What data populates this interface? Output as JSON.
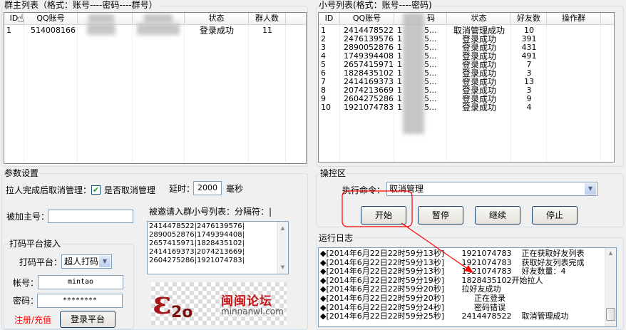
{
  "master_list": {
    "title": "群主列表（格式：账号----密码----群号）",
    "columns": [
      "ID",
      "QQ账号",
      "",
      "",
      "状态",
      "群人数"
    ],
    "rows": [
      {
        "id": "1",
        "qq": "514008166",
        "status": "登录成功",
        "count": "11"
      }
    ]
  },
  "sub_list": {
    "title": "小号列表(格式：账号----密码)",
    "columns": [
      "ID",
      "QQ账号",
      "码",
      "状态",
      "好友数",
      "操作群"
    ],
    "rows": [
      {
        "id": "1",
        "qq": "2414478522",
        "pw_a": "1",
        "pw_b": "5...",
        "status": "取消管理成功",
        "friends": "10"
      },
      {
        "id": "2",
        "qq": "2476139576",
        "pw_a": "1",
        "pw_b": "5...",
        "status": "登录成功",
        "friends": "391"
      },
      {
        "id": "3",
        "qq": "2890052876",
        "pw_a": "1",
        "pw_b": "5...",
        "status": "登录成功",
        "friends": "431"
      },
      {
        "id": "4",
        "qq": "1749394408",
        "pw_a": "1",
        "pw_b": "5...",
        "status": "登录成功",
        "friends": "491"
      },
      {
        "id": "5",
        "qq": "2657415971",
        "pw_a": "1",
        "pw_b": "5...",
        "status": "登录成功",
        "friends": "7"
      },
      {
        "id": "6",
        "qq": "1828435102",
        "pw_a": "1",
        "pw_b": "5...",
        "status": "登录成功",
        "friends": "3"
      },
      {
        "id": "7",
        "qq": "2414169373",
        "pw_a": "1",
        "pw_b": "5...",
        "status": "登录成功",
        "friends": "13"
      },
      {
        "id": "8",
        "qq": "2074213669",
        "pw_a": "1",
        "pw_b": "5...",
        "status": "登录成功",
        "friends": "3"
      },
      {
        "id": "9",
        "qq": "2604275286",
        "pw_a": "1",
        "pw_b": "5...",
        "status": "登录成功",
        "friends": "9"
      },
      {
        "id": "10",
        "qq": "1921074783",
        "pw_a": "1",
        "pw_b": "5...",
        "status": "登录成功",
        "friends": "4"
      }
    ]
  },
  "params": {
    "title": "参数设置",
    "cancel_admin_label": "拉人完成后取消管理：",
    "cancel_admin_checkbox": "是否取消管理",
    "cancel_admin_checked": true,
    "delay_label": "延时：",
    "delay_value": "2000",
    "delay_unit": "毫秒",
    "master_label": "被加主号：",
    "master_value": "",
    "invite_label": "被邀请入群小号列表：分隔符：|",
    "invite_lines": [
      "2414478522|2476139576|",
      "2890052876|1749394408|",
      "2657415971|1828435102|",
      "2414169373|2074213669|",
      "2604275286|1921074783|"
    ],
    "captcha": {
      "title": "打码平台接入",
      "platform_label": "打码平台：",
      "platform_value": "超人打码",
      "account_label": "帐号：",
      "account_value": "mintao",
      "password_label": "密码：",
      "password_value": "********",
      "register_link": "注册/充值",
      "login_button": "登录平台"
    },
    "logo": {
      "text": "闽闽论坛",
      "url_text": "minnanwl.com"
    }
  },
  "control": {
    "title": "操控区",
    "command_label": "执行命令：",
    "command_value": "取消管理",
    "buttons": [
      "开始",
      "暂停",
      "继续",
      "停止"
    ]
  },
  "log": {
    "title": "运行日志",
    "lines": [
      {
        "time": "◆[2014年6月22日22时59分13秒]",
        "msg": "       1921074783    正在获取好友列表"
      },
      {
        "time": "◆[2014年6月22日22时59分13秒]",
        "msg": "       1921074783    获取好友列表完成"
      },
      {
        "time": "◆[2014年6月22日22时59分13秒]",
        "msg": "       1921074783    好友数量：4"
      },
      {
        "time": "◆[2014年6月22日22时59分19秒]",
        "msg": "       1828435102开始拉人"
      },
      {
        "time": "◆[2014年6月22日22时59分20秒]",
        "msg": "       拉好友成功"
      },
      {
        "time": "◆[2014年6月22日22时59分20秒]",
        "msg": "            正在登录"
      },
      {
        "time": "◆[2014年6月22日22时59分24秒]",
        "msg": "            密码错误"
      },
      {
        "time": "◆[2014年6月22日22时59分25秒]",
        "msg": "       2414478522    取消管理成功"
      }
    ]
  },
  "colors": {
    "accent": "#ff0000",
    "border": "#7f9db9",
    "link": "#ff0000"
  }
}
